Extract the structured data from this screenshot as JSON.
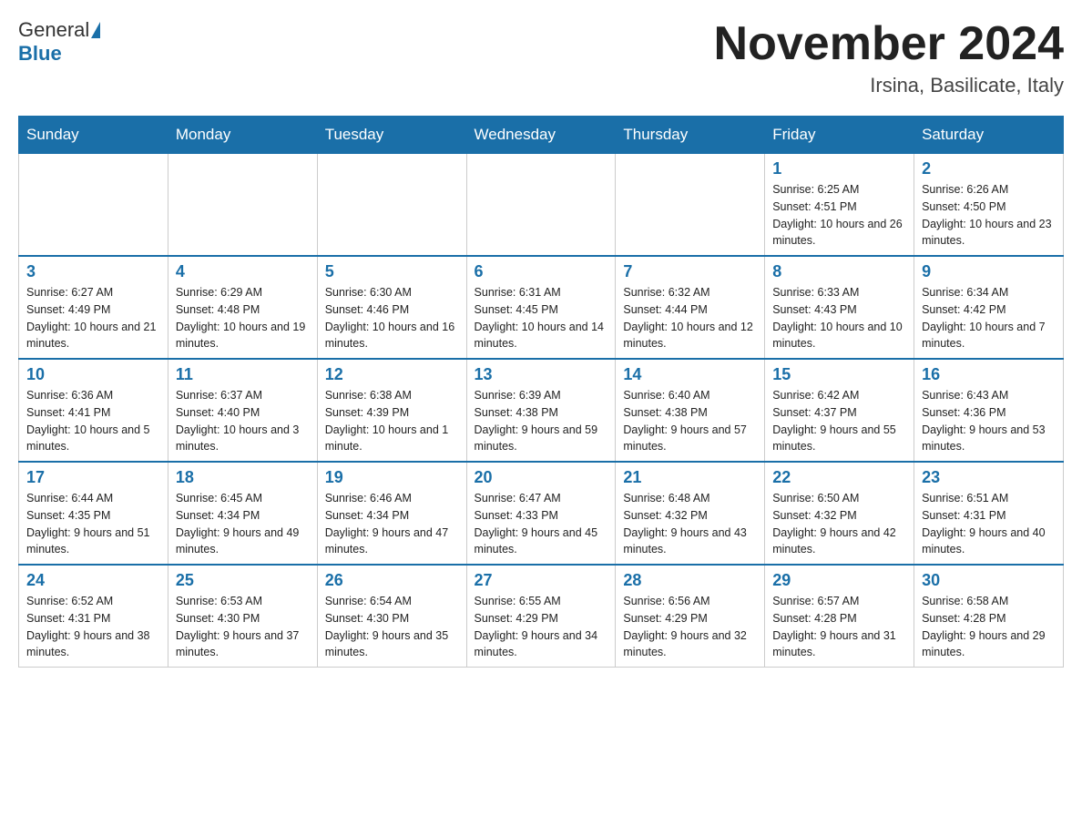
{
  "header": {
    "logo_general": "General",
    "logo_blue": "Blue",
    "month_title": "November 2024",
    "location": "Irsina, Basilicate, Italy"
  },
  "weekdays": [
    "Sunday",
    "Monday",
    "Tuesday",
    "Wednesday",
    "Thursday",
    "Friday",
    "Saturday"
  ],
  "weeks": [
    [
      {
        "day": "",
        "sunrise": "",
        "sunset": "",
        "daylight": ""
      },
      {
        "day": "",
        "sunrise": "",
        "sunset": "",
        "daylight": ""
      },
      {
        "day": "",
        "sunrise": "",
        "sunset": "",
        "daylight": ""
      },
      {
        "day": "",
        "sunrise": "",
        "sunset": "",
        "daylight": ""
      },
      {
        "day": "",
        "sunrise": "",
        "sunset": "",
        "daylight": ""
      },
      {
        "day": "1",
        "sunrise": "Sunrise: 6:25 AM",
        "sunset": "Sunset: 4:51 PM",
        "daylight": "Daylight: 10 hours and 26 minutes."
      },
      {
        "day": "2",
        "sunrise": "Sunrise: 6:26 AM",
        "sunset": "Sunset: 4:50 PM",
        "daylight": "Daylight: 10 hours and 23 minutes."
      }
    ],
    [
      {
        "day": "3",
        "sunrise": "Sunrise: 6:27 AM",
        "sunset": "Sunset: 4:49 PM",
        "daylight": "Daylight: 10 hours and 21 minutes."
      },
      {
        "day": "4",
        "sunrise": "Sunrise: 6:29 AM",
        "sunset": "Sunset: 4:48 PM",
        "daylight": "Daylight: 10 hours and 19 minutes."
      },
      {
        "day": "5",
        "sunrise": "Sunrise: 6:30 AM",
        "sunset": "Sunset: 4:46 PM",
        "daylight": "Daylight: 10 hours and 16 minutes."
      },
      {
        "day": "6",
        "sunrise": "Sunrise: 6:31 AM",
        "sunset": "Sunset: 4:45 PM",
        "daylight": "Daylight: 10 hours and 14 minutes."
      },
      {
        "day": "7",
        "sunrise": "Sunrise: 6:32 AM",
        "sunset": "Sunset: 4:44 PM",
        "daylight": "Daylight: 10 hours and 12 minutes."
      },
      {
        "day": "8",
        "sunrise": "Sunrise: 6:33 AM",
        "sunset": "Sunset: 4:43 PM",
        "daylight": "Daylight: 10 hours and 10 minutes."
      },
      {
        "day": "9",
        "sunrise": "Sunrise: 6:34 AM",
        "sunset": "Sunset: 4:42 PM",
        "daylight": "Daylight: 10 hours and 7 minutes."
      }
    ],
    [
      {
        "day": "10",
        "sunrise": "Sunrise: 6:36 AM",
        "sunset": "Sunset: 4:41 PM",
        "daylight": "Daylight: 10 hours and 5 minutes."
      },
      {
        "day": "11",
        "sunrise": "Sunrise: 6:37 AM",
        "sunset": "Sunset: 4:40 PM",
        "daylight": "Daylight: 10 hours and 3 minutes."
      },
      {
        "day": "12",
        "sunrise": "Sunrise: 6:38 AM",
        "sunset": "Sunset: 4:39 PM",
        "daylight": "Daylight: 10 hours and 1 minute."
      },
      {
        "day": "13",
        "sunrise": "Sunrise: 6:39 AM",
        "sunset": "Sunset: 4:38 PM",
        "daylight": "Daylight: 9 hours and 59 minutes."
      },
      {
        "day": "14",
        "sunrise": "Sunrise: 6:40 AM",
        "sunset": "Sunset: 4:38 PM",
        "daylight": "Daylight: 9 hours and 57 minutes."
      },
      {
        "day": "15",
        "sunrise": "Sunrise: 6:42 AM",
        "sunset": "Sunset: 4:37 PM",
        "daylight": "Daylight: 9 hours and 55 minutes."
      },
      {
        "day": "16",
        "sunrise": "Sunrise: 6:43 AM",
        "sunset": "Sunset: 4:36 PM",
        "daylight": "Daylight: 9 hours and 53 minutes."
      }
    ],
    [
      {
        "day": "17",
        "sunrise": "Sunrise: 6:44 AM",
        "sunset": "Sunset: 4:35 PM",
        "daylight": "Daylight: 9 hours and 51 minutes."
      },
      {
        "day": "18",
        "sunrise": "Sunrise: 6:45 AM",
        "sunset": "Sunset: 4:34 PM",
        "daylight": "Daylight: 9 hours and 49 minutes."
      },
      {
        "day": "19",
        "sunrise": "Sunrise: 6:46 AM",
        "sunset": "Sunset: 4:34 PM",
        "daylight": "Daylight: 9 hours and 47 minutes."
      },
      {
        "day": "20",
        "sunrise": "Sunrise: 6:47 AM",
        "sunset": "Sunset: 4:33 PM",
        "daylight": "Daylight: 9 hours and 45 minutes."
      },
      {
        "day": "21",
        "sunrise": "Sunrise: 6:48 AM",
        "sunset": "Sunset: 4:32 PM",
        "daylight": "Daylight: 9 hours and 43 minutes."
      },
      {
        "day": "22",
        "sunrise": "Sunrise: 6:50 AM",
        "sunset": "Sunset: 4:32 PM",
        "daylight": "Daylight: 9 hours and 42 minutes."
      },
      {
        "day": "23",
        "sunrise": "Sunrise: 6:51 AM",
        "sunset": "Sunset: 4:31 PM",
        "daylight": "Daylight: 9 hours and 40 minutes."
      }
    ],
    [
      {
        "day": "24",
        "sunrise": "Sunrise: 6:52 AM",
        "sunset": "Sunset: 4:31 PM",
        "daylight": "Daylight: 9 hours and 38 minutes."
      },
      {
        "day": "25",
        "sunrise": "Sunrise: 6:53 AM",
        "sunset": "Sunset: 4:30 PM",
        "daylight": "Daylight: 9 hours and 37 minutes."
      },
      {
        "day": "26",
        "sunrise": "Sunrise: 6:54 AM",
        "sunset": "Sunset: 4:30 PM",
        "daylight": "Daylight: 9 hours and 35 minutes."
      },
      {
        "day": "27",
        "sunrise": "Sunrise: 6:55 AM",
        "sunset": "Sunset: 4:29 PM",
        "daylight": "Daylight: 9 hours and 34 minutes."
      },
      {
        "day": "28",
        "sunrise": "Sunrise: 6:56 AM",
        "sunset": "Sunset: 4:29 PM",
        "daylight": "Daylight: 9 hours and 32 minutes."
      },
      {
        "day": "29",
        "sunrise": "Sunrise: 6:57 AM",
        "sunset": "Sunset: 4:28 PM",
        "daylight": "Daylight: 9 hours and 31 minutes."
      },
      {
        "day": "30",
        "sunrise": "Sunrise: 6:58 AM",
        "sunset": "Sunset: 4:28 PM",
        "daylight": "Daylight: 9 hours and 29 minutes."
      }
    ]
  ]
}
